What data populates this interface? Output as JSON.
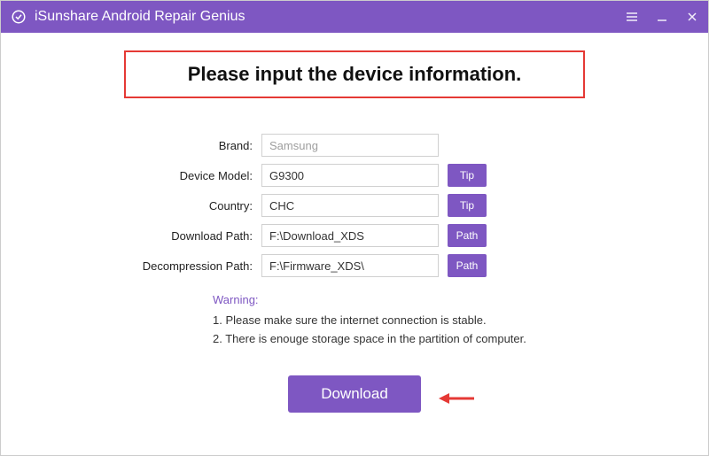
{
  "titlebar": {
    "app_title": "iSunshare Android Repair Genius"
  },
  "heading": "Please input the device information.",
  "form": {
    "brand": {
      "label": "Brand:",
      "value": "Samsung"
    },
    "model": {
      "label": "Device Model:",
      "value": "G9300",
      "btn": "Tip"
    },
    "country": {
      "label": "Country:",
      "value": "CHC",
      "btn": "Tip"
    },
    "download_path": {
      "label": "Download Path:",
      "value": "F:\\Download_XDS",
      "btn": "Path"
    },
    "decompression_path": {
      "label": "Decompression Path:",
      "value": "F:\\Firmware_XDS\\",
      "btn": "Path"
    }
  },
  "warning": {
    "title": "Warning:",
    "line1": "1. Please make sure the internet connection is stable.",
    "line2": "2. There is enouge storage space in the partition of computer."
  },
  "download_label": "Download"
}
